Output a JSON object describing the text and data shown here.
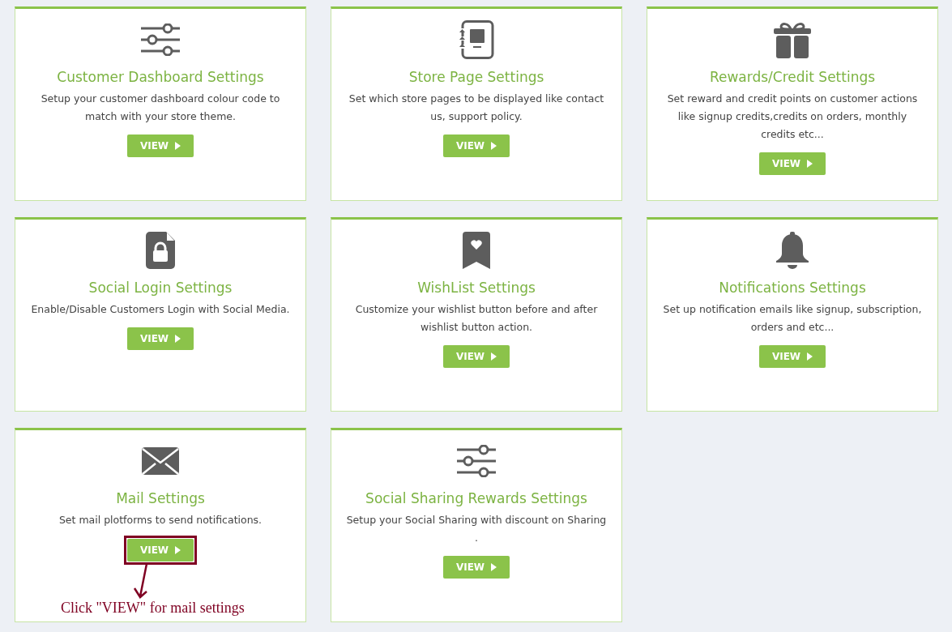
{
  "cards": [
    {
      "kind": "sliders",
      "title": "Customer Dashboard Settings",
      "description": "Setup your customer dashboard colour code to match with your store theme.",
      "button": "VIEW",
      "highlighted": false
    },
    {
      "kind": "notebook",
      "title": "Store Page Settings",
      "description": "Set which store pages to be displayed like contact us, support policy.",
      "button": "VIEW",
      "highlighted": false
    },
    {
      "kind": "gift",
      "title": "Rewards/Credit Settings",
      "description": "Set reward and credit points on customer actions like signup credits,credits on orders, monthly credits etc...",
      "button": "VIEW",
      "highlighted": false
    },
    {
      "kind": "file-lock",
      "title": "Social Login Settings",
      "description": "Enable/Disable Customers Login with Social Media.",
      "button": "VIEW",
      "highlighted": false
    },
    {
      "kind": "bookmark-heart",
      "title": "WishList Settings",
      "description": "Customize your wishlist button before and after wishlist button action.",
      "button": "VIEW",
      "highlighted": false
    },
    {
      "kind": "bell",
      "title": "Notifications Settings",
      "description": "Set up notification emails like signup, subscription, orders and etc...",
      "button": "VIEW",
      "highlighted": false
    },
    {
      "kind": "envelope",
      "title": "Mail Settings",
      "description": "Set mail plotforms to send notifications.",
      "button": "VIEW",
      "highlighted": true,
      "note": "Click \"VIEW\" for mail settings"
    },
    {
      "kind": "sliders",
      "title": "Social Sharing Rewards Settings",
      "description": "Setup your Social Sharing with discount on Sharing\n.",
      "button": "VIEW",
      "highlighted": false
    }
  ]
}
